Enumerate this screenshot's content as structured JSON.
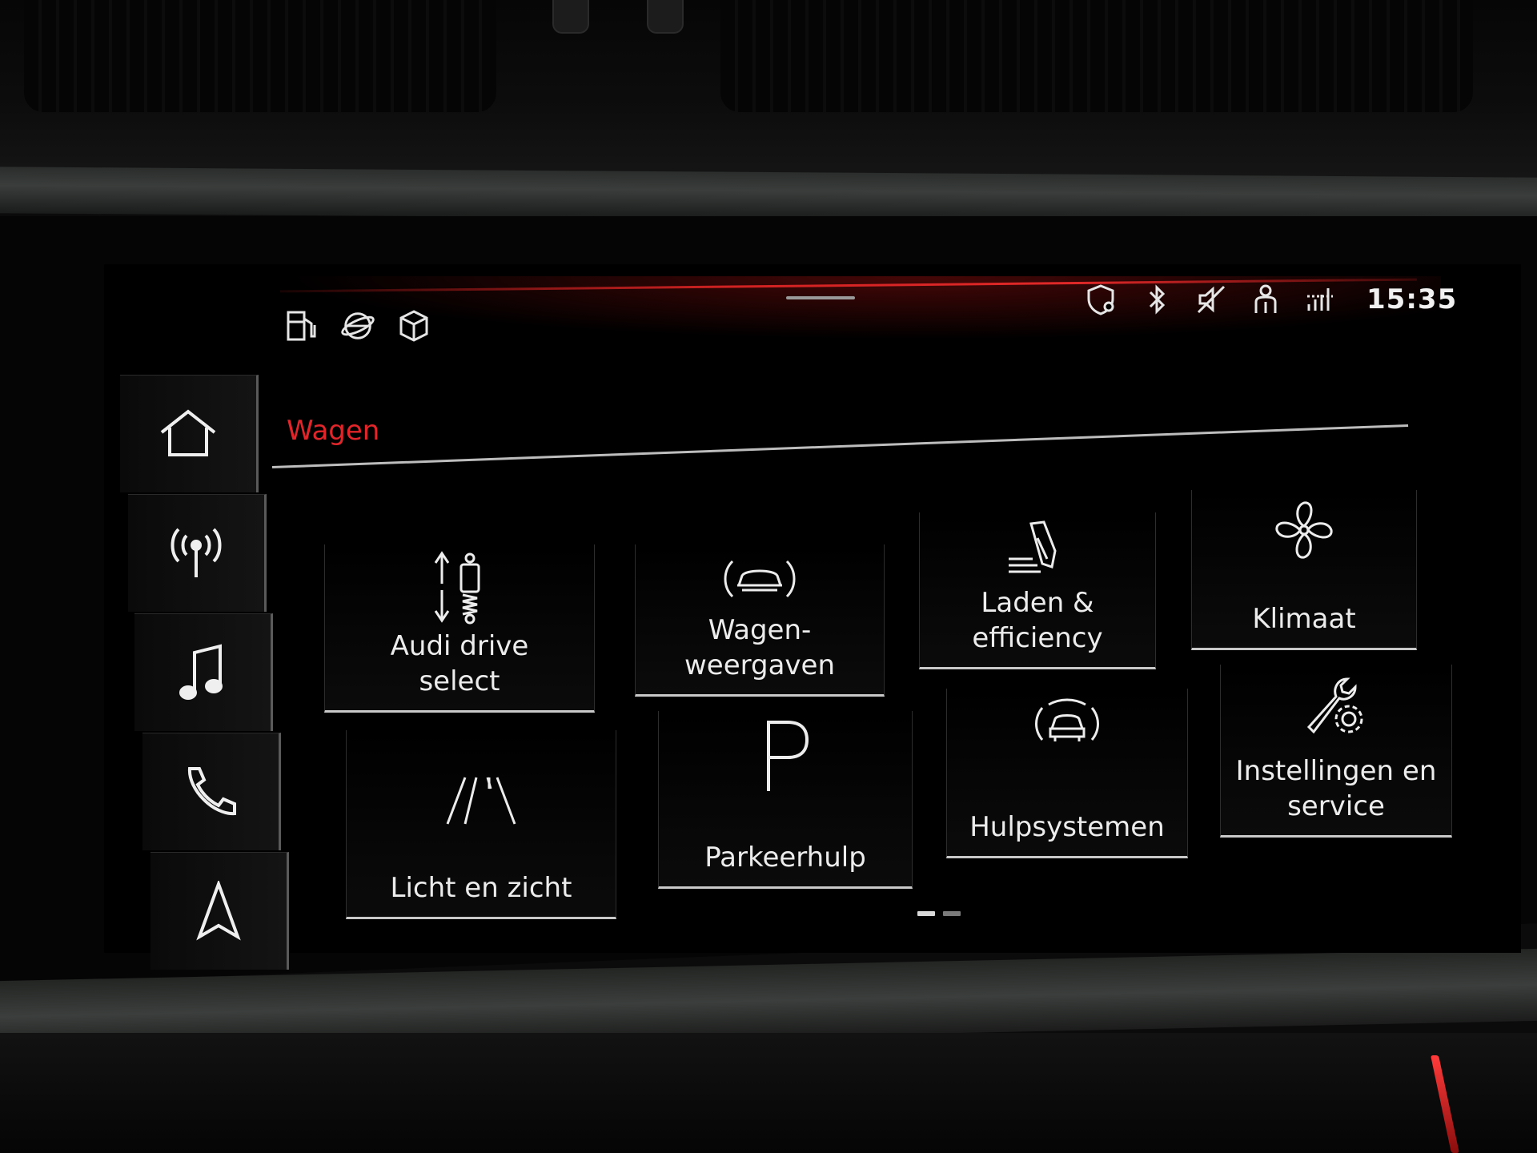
{
  "status_bar": {
    "left_icons": [
      "fuel-icon",
      "globe-icon",
      "cube-icon"
    ],
    "right_icons": [
      "location-shield-icon",
      "bluetooth-icon",
      "mute-icon",
      "person-icon",
      "signal-icon"
    ],
    "time": "15:35"
  },
  "sidebar": {
    "items": [
      {
        "name": "home",
        "icon": "home-icon"
      },
      {
        "name": "radio",
        "icon": "radio-antenna-icon"
      },
      {
        "name": "media",
        "icon": "music-note-icon"
      },
      {
        "name": "phone",
        "icon": "phone-icon"
      },
      {
        "name": "navigation",
        "icon": "navigation-arrow-icon"
      }
    ]
  },
  "page": {
    "title": "Wagen"
  },
  "tiles": [
    {
      "label": "Audi drive\nselect",
      "icon": "drive-select-icon"
    },
    {
      "label": "Wagen-\nweergaven",
      "icon": "car-views-icon"
    },
    {
      "label": "Laden &\nefficiency",
      "icon": "charging-plug-icon"
    },
    {
      "label": "Klimaat",
      "icon": "fan-icon"
    },
    {
      "label": "Licht en zicht",
      "icon": "road-light-icon"
    },
    {
      "label": "Parkeerhulp",
      "icon": "parking-icon"
    },
    {
      "label": "Hulpsystemen",
      "icon": "assist-car-icon"
    },
    {
      "label": "Instellingen en\nservice",
      "icon": "settings-wrench-icon"
    }
  ],
  "pager": {
    "pages": 2,
    "current": 1
  },
  "colors": {
    "accent": "#e0262a",
    "tile_border": "#c9c9c9",
    "background": "#000000"
  }
}
